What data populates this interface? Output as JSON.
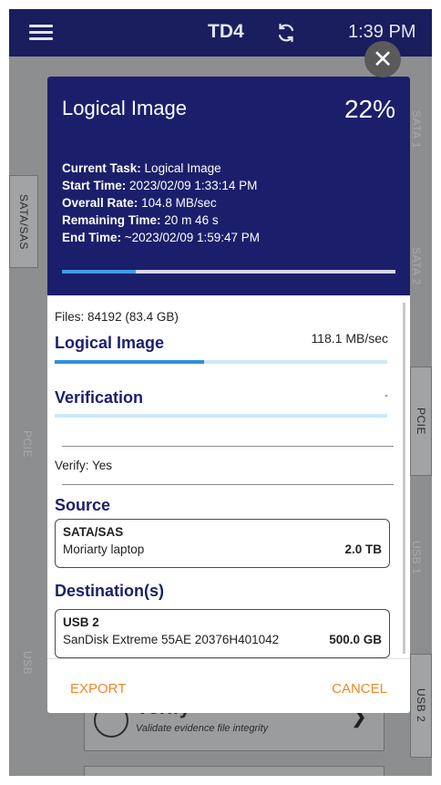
{
  "topbar": {
    "device": "TD4",
    "time": "1:39 PM",
    "menu_icon": "hamburger-icon",
    "sync_icon": "sync-icon"
  },
  "background": {
    "side_tabs": {
      "sata_sas": "SATA/SAS",
      "pcie": "PCIE",
      "usb2": "USB 2",
      "sata1": "SATA 1",
      "sata2": "SATA 2",
      "pcie_left": "PCIE",
      "usb1": "USB 1",
      "usb_left": "USB"
    },
    "verify_card": {
      "title": "Verify",
      "subtitle": "Validate evidence file integrity"
    }
  },
  "dialog": {
    "title": "Logical Image",
    "percent": "22%",
    "progress": 0.22,
    "info": {
      "current_task_label": "Current Task:",
      "current_task": "Logical Image",
      "start_time_label": "Start Time:",
      "start_time": "2023/02/09 1:33:14 PM",
      "overall_rate_label": "Overall Rate:",
      "overall_rate": "104.8 MB/sec",
      "remaining_label": "Remaining Time:",
      "remaining": "20 m 46 s",
      "end_time_label": "End Time:",
      "end_time": "~2023/02/09 1:59:47 PM"
    },
    "files_label": "Files:",
    "files": "84192 (83.4 GB)",
    "logical_image": {
      "title": "Logical Image",
      "rate": "118.1 MB/sec",
      "progress": 0.45
    },
    "verification": {
      "title": "Verification",
      "value": "-",
      "progress": 0
    },
    "verify_label": "Verify:",
    "verify_value": "Yes",
    "source": {
      "title": "Source",
      "name": "SATA/SAS",
      "description": "Moriarty laptop",
      "size": "2.0 TB"
    },
    "destination": {
      "title": "Destination(s)",
      "name": "USB 2",
      "description": "SanDisk Extreme 55AE 20376H401042",
      "size": "500.0 GB"
    },
    "export_label": "EXPORT",
    "cancel_label": "CANCEL"
  },
  "colors": {
    "header_bg": "#1b1f6b",
    "progress_fill": "#2d8ee0",
    "action": "#f0882a"
  }
}
